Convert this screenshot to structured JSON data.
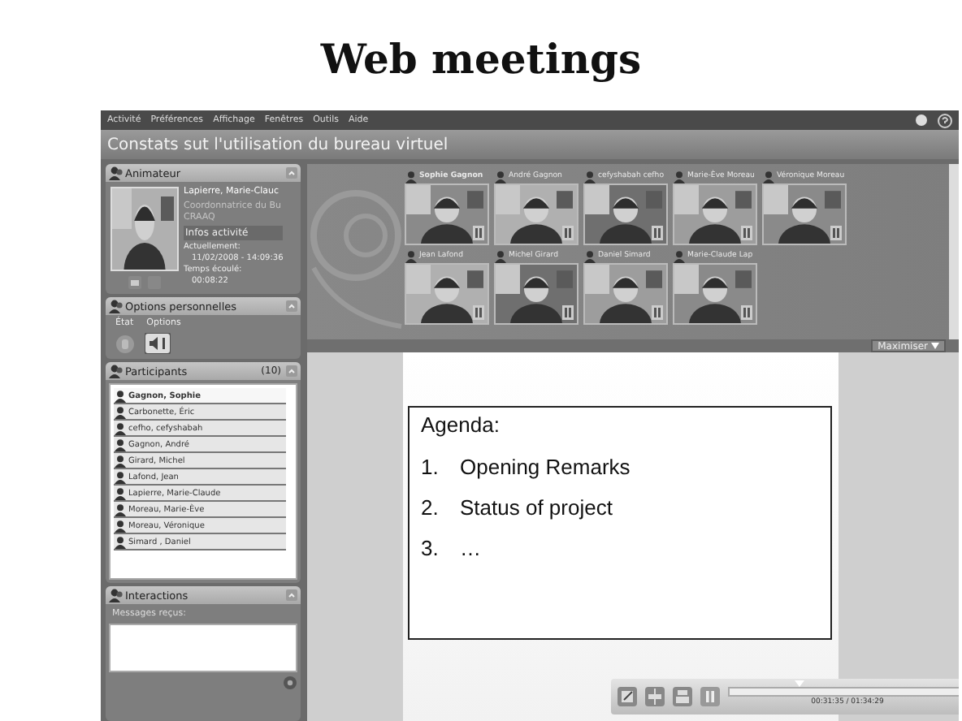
{
  "slide_title": "Web meetings",
  "menu": [
    "Activité",
    "Préférences",
    "Affichage",
    "Fenêtres",
    "Outils",
    "Aide"
  ],
  "window_title": "Constats sut l'utilisation du bureau virtuel",
  "host_panel": {
    "title": "Animateur",
    "name": "Lapierre, Marie-Clauc",
    "role": "Coordonnatrice du Bu",
    "org": "CRAAQ",
    "info_heading": "Infos activité",
    "current_label": "Actuellement:",
    "current_value": "11/02/2008 - 14:09:36",
    "elapsed_label": "Temps écoulé:",
    "elapsed_value": "00:08:22"
  },
  "options_panel": {
    "title": "Options personnelles",
    "tabs": [
      "État",
      "Options"
    ]
  },
  "participants_panel": {
    "title": "Participants",
    "count": "(10)",
    "participants": [
      {
        "name": "Gagnon, Sophie",
        "selected": true
      },
      {
        "name": "Carbonette, Éric",
        "selected": false
      },
      {
        "name": "cefho, cefyshabah",
        "selected": false
      },
      {
        "name": "Gagnon, André",
        "selected": false
      },
      {
        "name": "Girard, Michel",
        "selected": false
      },
      {
        "name": "Lafond, Jean",
        "selected": false
      },
      {
        "name": "Lapierre, Marie-Claude",
        "selected": false
      },
      {
        "name": "Moreau, Marie-Ève",
        "selected": false
      },
      {
        "name": "Moreau, Véronique",
        "selected": false
      },
      {
        "name": "Simard , Daniel",
        "selected": false
      }
    ]
  },
  "interactions_panel": {
    "title": "Interactions",
    "label": "Messages reçus:"
  },
  "video_tiles": [
    {
      "name": "Sophie Gagnon",
      "selected": true
    },
    {
      "name": "André Gagnon",
      "selected": false
    },
    {
      "name": "cefyshabah cefho",
      "selected": false
    },
    {
      "name": "Marie-Ève Moreau",
      "selected": false
    },
    {
      "name": "Véronique Moreau",
      "selected": false
    },
    {
      "name": "Jean Lafond",
      "selected": false
    },
    {
      "name": "Michel Girard",
      "selected": false
    },
    {
      "name": "Daniel Simard",
      "selected": false
    },
    {
      "name": "Marie-Claude Lap",
      "selected": false
    }
  ],
  "maximize_button": "Maximiser",
  "agenda": {
    "heading": "Agenda:",
    "items": [
      {
        "number": "1.",
        "text": "Opening Remarks"
      },
      {
        "number": "2.",
        "text": "Status of project"
      },
      {
        "number": "3.",
        "text": "…"
      }
    ]
  },
  "player": {
    "time": "00:31:35 / 01:34:29",
    "level": 0.3
  }
}
